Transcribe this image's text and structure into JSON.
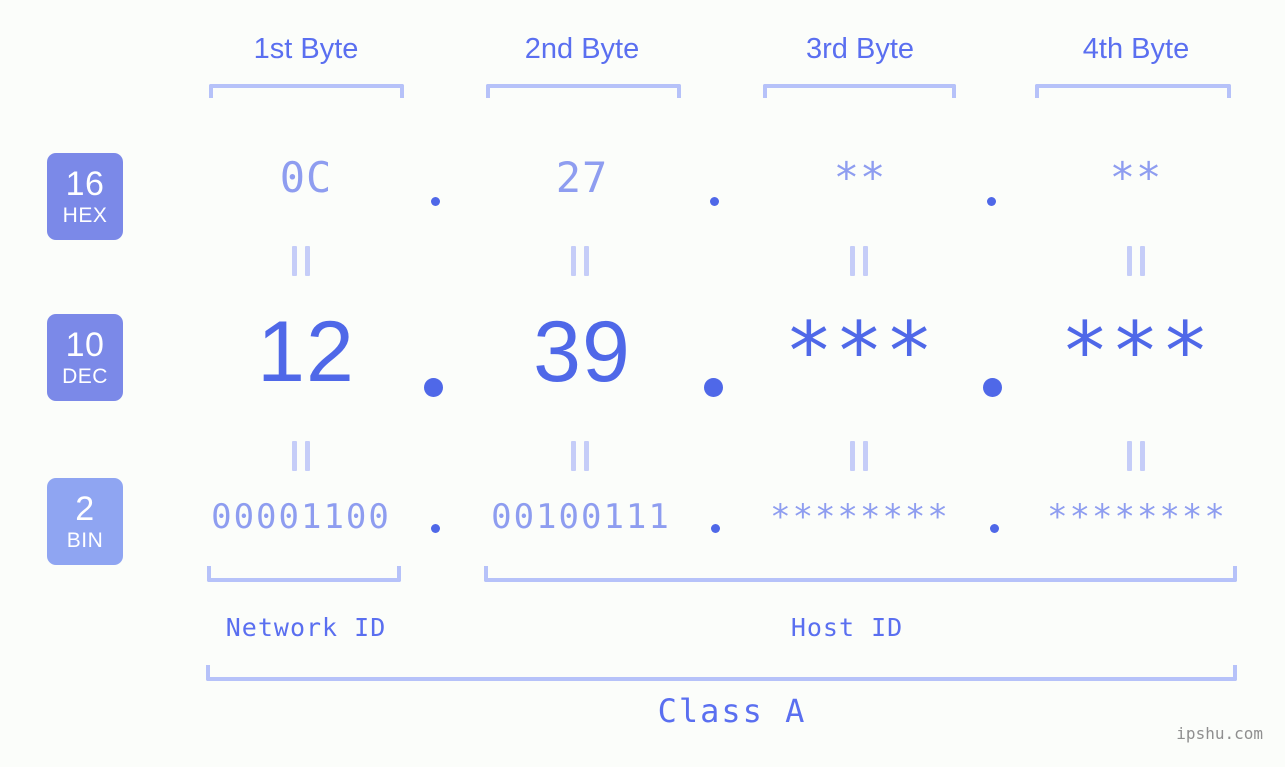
{
  "meta": {
    "watermark": "ipshu.com"
  },
  "columns": [
    {
      "header": "1st Byte"
    },
    {
      "header": "2nd Byte"
    },
    {
      "header": "3rd Byte"
    },
    {
      "header": "4th Byte"
    }
  ],
  "rows": [
    {
      "key": "hex",
      "base": "16",
      "abbr": "HEX",
      "values": [
        "0C",
        "27",
        "**",
        "**"
      ]
    },
    {
      "key": "dec",
      "base": "10",
      "abbr": "DEC",
      "values": [
        "12",
        "39",
        "***",
        "***"
      ]
    },
    {
      "key": "bin",
      "base": "2",
      "abbr": "BIN",
      "values": [
        "00001100",
        "00100111",
        "********",
        "********"
      ]
    }
  ],
  "separators": {
    "dot": "."
  },
  "equality_mark": "=",
  "segments": {
    "network_id": "Network ID",
    "host_id": "Host ID",
    "class": "Class A"
  },
  "colors": {
    "background": "#fbfdfa",
    "accent_strong": "#4f68e8",
    "accent_medium": "#5a6ff0",
    "accent_light": "#8e9df0",
    "bracket": "#b6c2f9",
    "badge": "#7b89e8",
    "badge_bin": "#8fa5f2",
    "equality": "#c5cdf8",
    "watermark": "#8f8f8f"
  },
  "chart_data": {
    "type": "table",
    "title": "IP Address Byte Breakdown — Class A",
    "categories": [
      "1st Byte",
      "2nd Byte",
      "3rd Byte",
      "4th Byte"
    ],
    "series": [
      {
        "name": "16 HEX",
        "values": [
          "0C",
          "27",
          "**",
          "**"
        ]
      },
      {
        "name": "10 DEC",
        "values": [
          "12",
          "39",
          "***",
          "***"
        ]
      },
      {
        "name": "2 BIN",
        "values": [
          "00001100",
          "00100111",
          "********",
          "********"
        ]
      }
    ],
    "annotations": [
      "Network ID",
      "Host ID",
      "Class A"
    ],
    "xlabel": "",
    "ylabel": "",
    "grid": false,
    "legend": "left"
  }
}
